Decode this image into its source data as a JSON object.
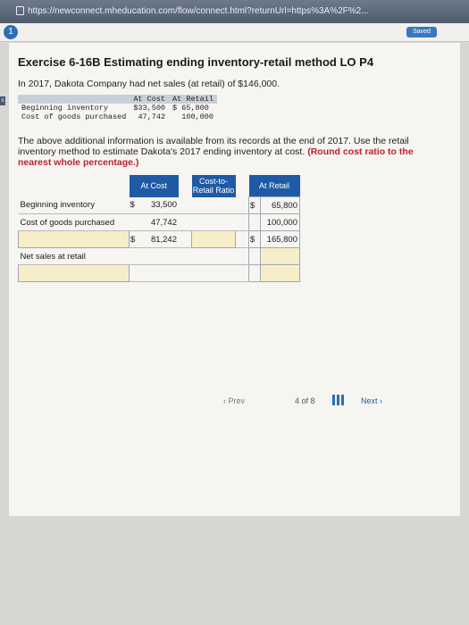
{
  "browser": {
    "url": "https://newconnect.mheducation.com/flow/connect.html?returnUrl=https%3A%2F%2..."
  },
  "header": {
    "badge": "1",
    "saved_label": "Saved"
  },
  "exercise": {
    "title": "Exercise 6-16B Estimating ending inventory-retail method LO P4",
    "intro": "In 2017, Dakota Company had net sales (at retail) of $146,000.",
    "small_table": {
      "headers": [
        "",
        "At Cost",
        "At Retail"
      ],
      "rows": [
        {
          "label": "Beginning inventory",
          "cost": "$33,500",
          "retail": "$ 65,800"
        },
        {
          "label": "Cost of goods purchased",
          "cost": "47,742",
          "retail": "100,000"
        }
      ]
    },
    "instructions": "The above additional information is available from its records at the end of 2017. Use the retail inventory method to estimate Dakota's 2017 ending inventory at cost.",
    "instructions_emphasis": "(Round cost ratio to the nearest whole percentage.)"
  },
  "work_table": {
    "headers": {
      "cost": "At Cost",
      "ratio": "Cost-to-Retail Ratio",
      "retail": "At Retail"
    },
    "rows": [
      {
        "label": "Beginning inventory",
        "cost_sym": "$",
        "cost": "33,500",
        "retail_sym": "$",
        "retail": "65,800"
      },
      {
        "label": "Cost of goods purchased",
        "cost_sym": "",
        "cost": "47,742",
        "retail_sym": "",
        "retail": "100,000"
      },
      {
        "label": "",
        "cost_sym": "$",
        "cost": "81,242",
        "retail_sym": "$",
        "retail": "165,800"
      },
      {
        "label": "Net sales at retail",
        "cost_sym": "",
        "cost": "",
        "retail_sym": "",
        "retail": ""
      },
      {
        "label": "",
        "cost_sym": "",
        "cost": "",
        "retail_sym": "",
        "retail": ""
      }
    ]
  },
  "pagination": {
    "prev_label": "Prev",
    "current": "4",
    "of_label": "of 8",
    "next_label": "Next"
  },
  "colors": {
    "header_blue": "#1f5aa6",
    "input_fill": "#f7eec9",
    "emphasis_red": "#c0212b"
  }
}
